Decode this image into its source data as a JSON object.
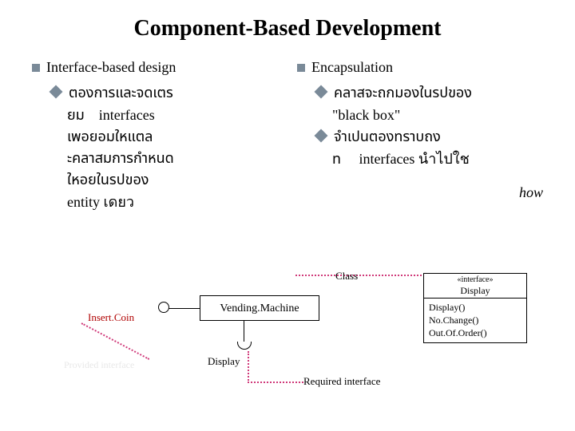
{
  "title": "Component-Based Development",
  "left": {
    "heading": "Interface-based design",
    "line1": "ตองการและจดเตร",
    "line2a": "ยม",
    "line2b": "interfaces",
    "line3": "เพอยอมใหแตล",
    "line4": "ะคลาสมการกำหนด",
    "line5": "ใหอยในรปของ",
    "line6": "entity เดยว"
  },
  "right": {
    "heading": "Encapsulation",
    "line1": "คลาสจะถกมองในรปของ",
    "line2": "\"black box\"",
    "line3": "จำเปนตองทราบถง",
    "line4a": "ท",
    "line4b": "interfaces นำไปใช"
  },
  "how_label": "how",
  "diagram": {
    "class_label": "Class",
    "required_label": "Required interface",
    "provided_label": "Provided interface",
    "insert_coin": "Insert.Coin",
    "display": "Display",
    "component": "Vending.Machine",
    "iface_stereotype": "«interface»",
    "iface_name": "Display",
    "iface_ops": [
      "Display()",
      "No.Change()",
      "Out.Of.Order()"
    ]
  }
}
